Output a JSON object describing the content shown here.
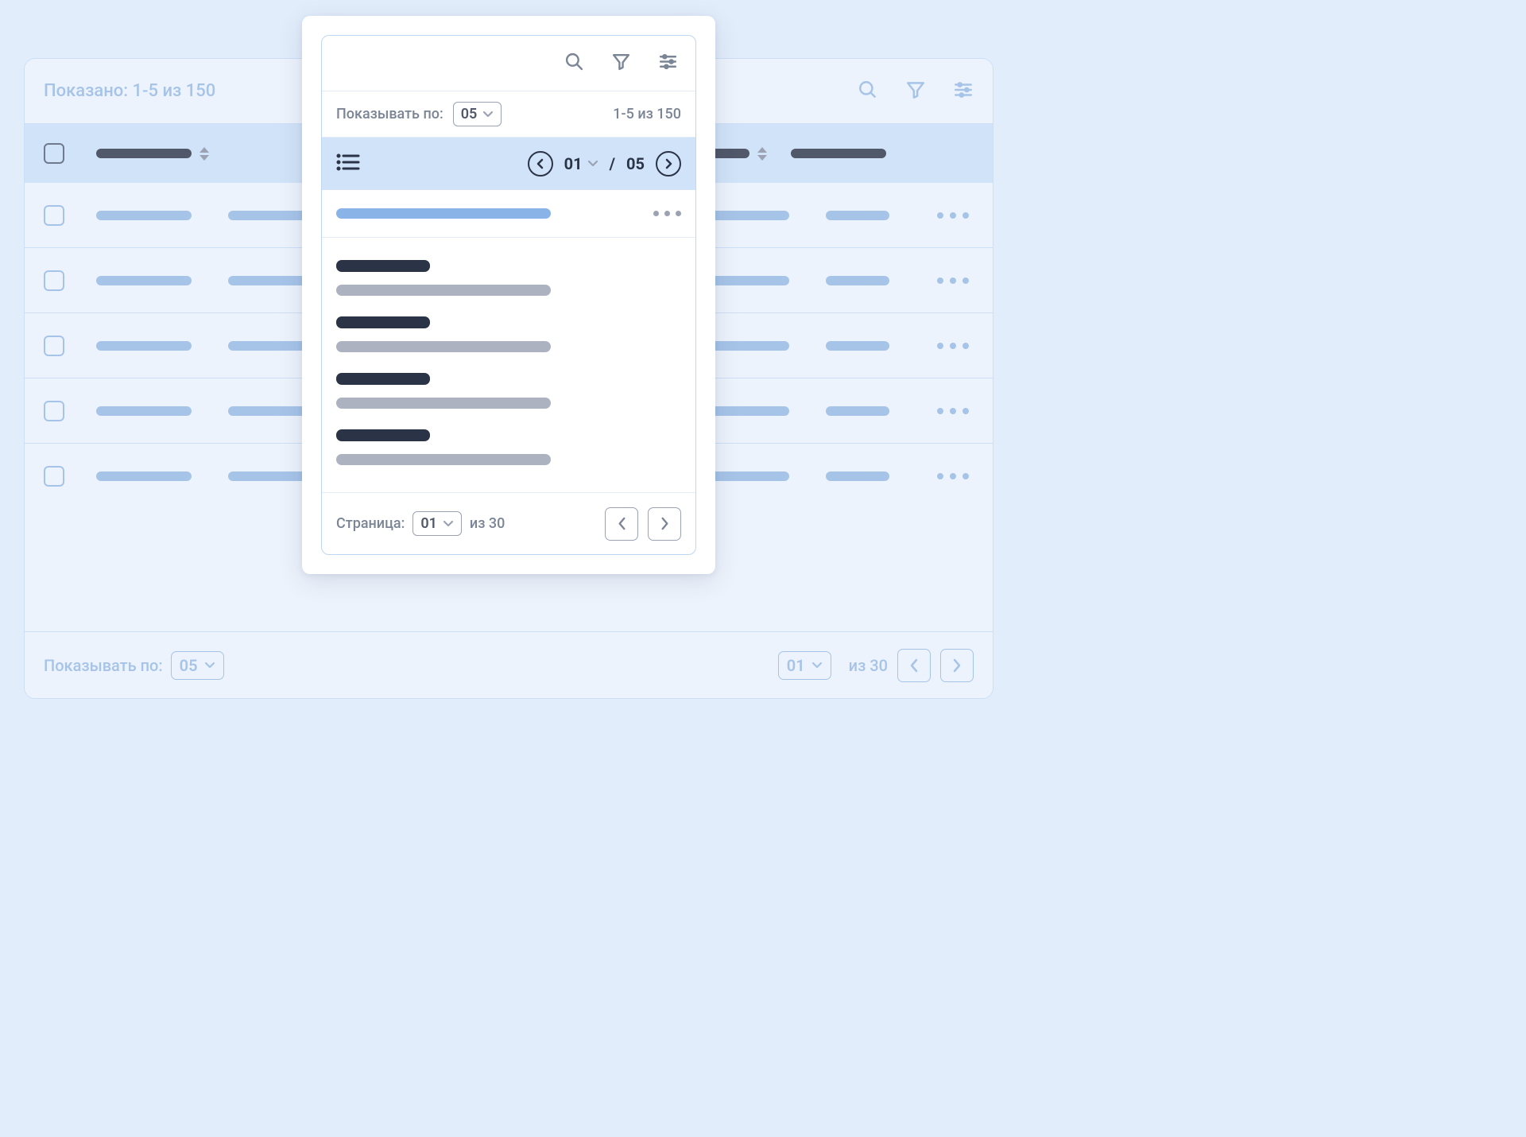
{
  "bg": {
    "shown_label": "Показано: 1-5 из 150",
    "footer": {
      "per_page_label": "Показывать по:",
      "per_page_value": "05",
      "page_value": "01",
      "of_label": "из 30"
    }
  },
  "card": {
    "per_page_label": "Показывать по:",
    "per_page_value": "05",
    "range_label": "1-5 из 150",
    "nav": {
      "current_page": "01",
      "sep": "/",
      "total_pages": "05"
    },
    "footer": {
      "page_label": "Страница:",
      "page_value": "01",
      "of_label": "из 30"
    }
  }
}
